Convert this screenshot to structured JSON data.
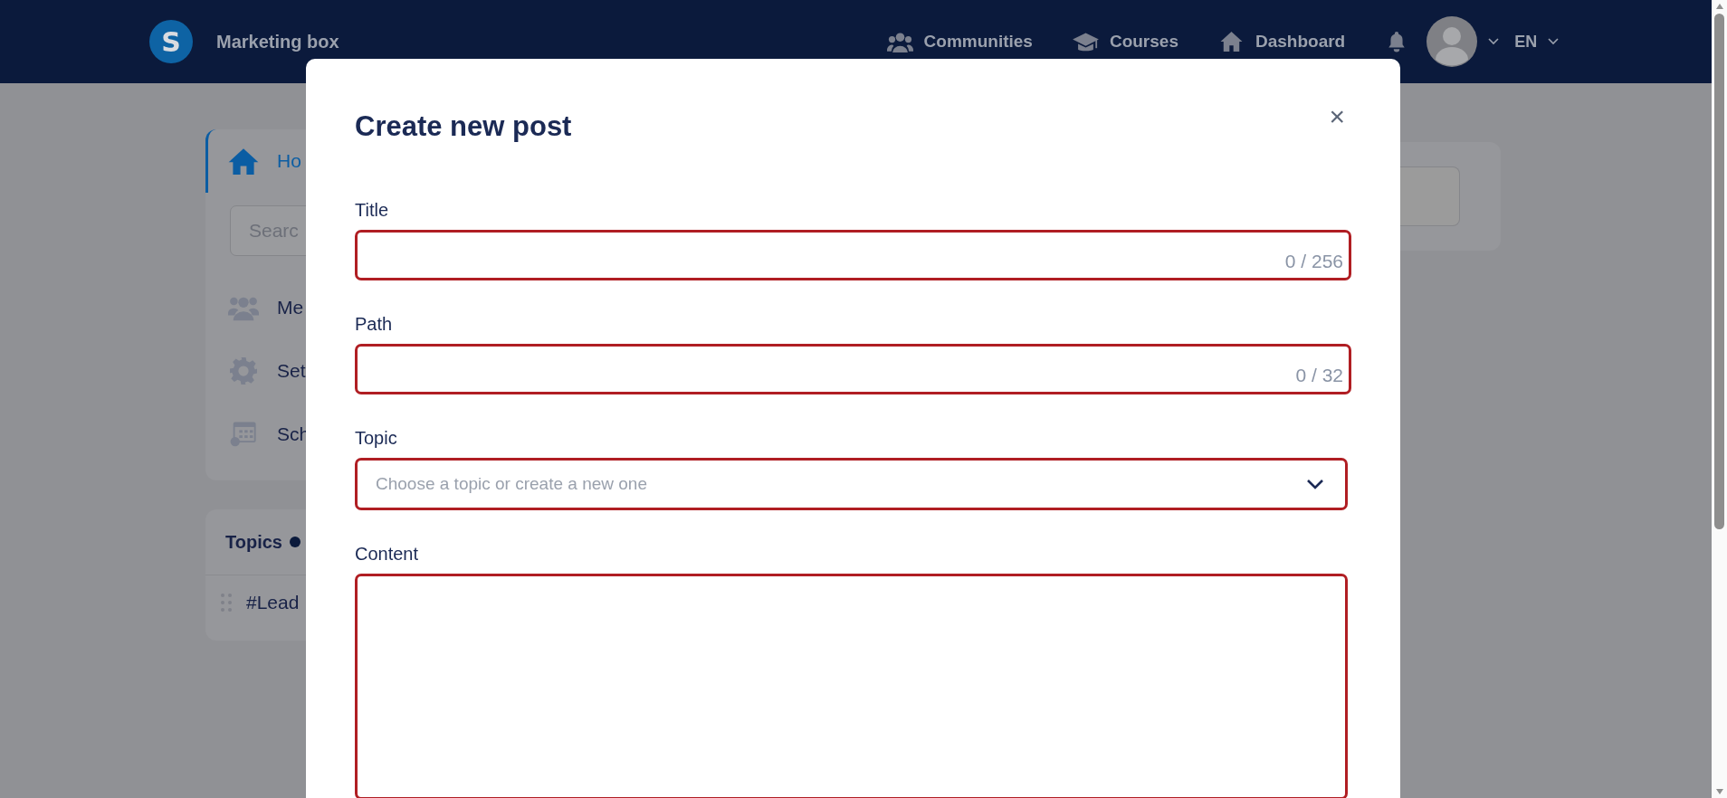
{
  "header": {
    "logo_letter": "S",
    "brand": "Marketing box",
    "nav": [
      {
        "label": "Communities"
      },
      {
        "label": "Courses"
      },
      {
        "label": "Dashboard"
      }
    ],
    "language": "EN"
  },
  "sidebar": {
    "items": [
      {
        "label": "Ho",
        "selected": true
      },
      {
        "label": "Me",
        "selected": false
      },
      {
        "label": "Set",
        "selected": false
      },
      {
        "label": "Sch",
        "selected": false
      }
    ],
    "search": {
      "placeholder": "Searc"
    }
  },
  "topics": {
    "title": "Topics",
    "items": [
      {
        "label": "#Lead"
      }
    ]
  },
  "modal": {
    "title": "Create new post",
    "close": "×",
    "fields": [
      {
        "kind": "text",
        "label": "Title",
        "counter": "0 / 256",
        "invalid": true
      },
      {
        "kind": "text",
        "label": "Path",
        "counter": "0 / 32",
        "invalid": true
      },
      {
        "kind": "select",
        "label": "Topic",
        "placeholder": "Choose a topic or create a new one",
        "invalid": true
      },
      {
        "kind": "textarea",
        "label": "Content",
        "invalid": true
      }
    ]
  }
}
